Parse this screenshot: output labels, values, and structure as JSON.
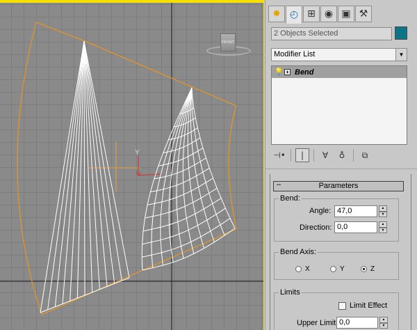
{
  "viewport": {
    "viewcube_label": "FRONT",
    "axis_label": "Y",
    "wire_color": "#ffffff",
    "bbox_color": "#e09528",
    "border_color": "#f6e000"
  },
  "panel": {
    "tabs": [
      {
        "name": "create-tab",
        "glyph": "✸",
        "icon": "create-icon"
      },
      {
        "name": "modify-tab",
        "glyph": "◴",
        "icon": "modify-icon"
      },
      {
        "name": "hierarchy-tab",
        "glyph": "⊞",
        "icon": "hierarchy-icon"
      },
      {
        "name": "motion-tab",
        "glyph": "◉",
        "icon": "motion-icon"
      },
      {
        "name": "display-tab",
        "glyph": "▣",
        "icon": "display-icon"
      },
      {
        "name": "utilities-tab",
        "glyph": "⚒",
        "icon": "hammer-icon"
      }
    ],
    "object_name": "2 Objects Selected",
    "object_color": "#0e7588",
    "modifier_list": "Modifier List",
    "stack": [
      {
        "label": "Bend"
      }
    ],
    "stack_tools": {
      "pin": "⊣•",
      "show_end": "|",
      "unique": "∀",
      "remove": "♁",
      "configure": "⧉"
    }
  },
  "parameters": {
    "title": "Parameters",
    "bend_group": "Bend:",
    "angle_label": "Angle:",
    "angle_value": "47,0",
    "direction_label": "Direction:",
    "direction_value": "0,0",
    "axis_group": "Bend Axis:",
    "axes": [
      {
        "label": "X",
        "selected": false
      },
      {
        "label": "Y",
        "selected": false
      },
      {
        "label": "Z",
        "selected": true
      }
    ],
    "limits_group": "Limits",
    "limit_effect_label": "Limit Effect",
    "limit_effect_checked": false,
    "upper_limit_label": "Upper Limit:",
    "upper_limit_value": "0,0"
  }
}
